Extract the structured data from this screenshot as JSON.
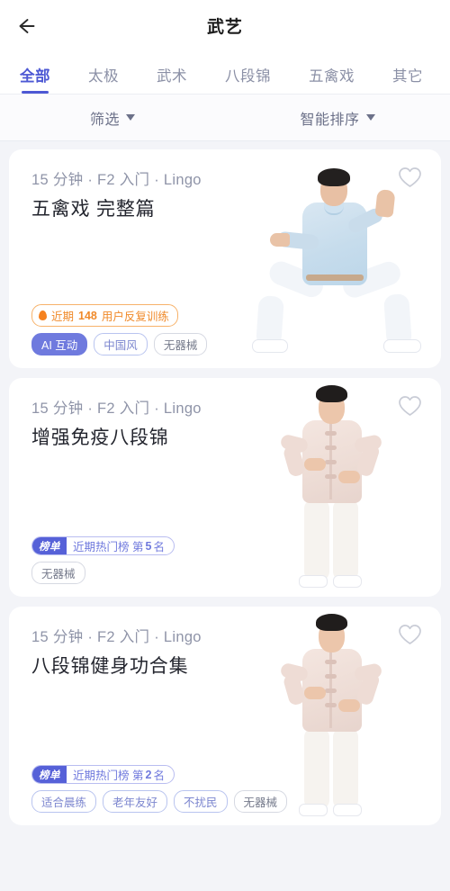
{
  "header": {
    "title": "武艺",
    "back_icon": "arrow-left-icon"
  },
  "tabs": [
    {
      "label": "全部",
      "active": true
    },
    {
      "label": "太极",
      "active": false
    },
    {
      "label": "武术",
      "active": false
    },
    {
      "label": "八段锦",
      "active": false
    },
    {
      "label": "五禽戏",
      "active": false
    },
    {
      "label": "其它",
      "active": false
    }
  ],
  "filters": [
    {
      "label": "筛选",
      "icon": "chevron-down-icon"
    },
    {
      "label": "智能排序",
      "icon": "chevron-down-icon"
    }
  ],
  "colors": {
    "accent": "#4d58d4",
    "tag_blue": "#7c86cf",
    "tag_gray": "#767b8c",
    "badge_orange": "#f08a2a",
    "rank_purple": "#5661d8",
    "page_bg": "#f3f4f8",
    "card_bg": "#ffffff"
  },
  "cards": [
    {
      "meta": "15 分钟 · F2 入门 · Lingo",
      "title": "五禽戏 完整篇",
      "favorite_icon": "heart-outline-icon",
      "hot_badge": {
        "icon": "flame-icon",
        "prefix": "近期",
        "count": "148",
        "suffix": "用户反复训练"
      },
      "rank_badge": null,
      "tags": [
        {
          "label": "AI 互动",
          "style": "solid"
        },
        {
          "label": "中国风",
          "style": "blue"
        },
        {
          "label": "无器械",
          "style": "gray"
        }
      ],
      "image": "person-tai-chi-blue-horse-stance"
    },
    {
      "meta": "15 分钟 · F2 入门 · Lingo",
      "title": "增强免疫八段锦",
      "favorite_icon": "heart-outline-icon",
      "hot_badge": null,
      "rank_badge": {
        "label": "榜单",
        "prefix": "近期热门榜 第",
        "rank": "5",
        "suffix": "名"
      },
      "tags": [
        {
          "label": "无器械",
          "style": "gray"
        }
      ],
      "image": "person-tang-suit-standing"
    },
    {
      "meta": "15 分钟 · F2 入门 · Lingo",
      "title": "八段锦健身功合集",
      "favorite_icon": "heart-outline-icon",
      "hot_badge": null,
      "rank_badge": {
        "label": "榜单",
        "prefix": "近期热门榜 第",
        "rank": "2",
        "suffix": "名"
      },
      "tags": [
        {
          "label": "适合晨练",
          "style": "blue"
        },
        {
          "label": "老年友好",
          "style": "blue"
        },
        {
          "label": "不扰民",
          "style": "blue"
        },
        {
          "label": "无器械",
          "style": "gray"
        }
      ],
      "image": "person-tang-suit-standing"
    }
  ]
}
